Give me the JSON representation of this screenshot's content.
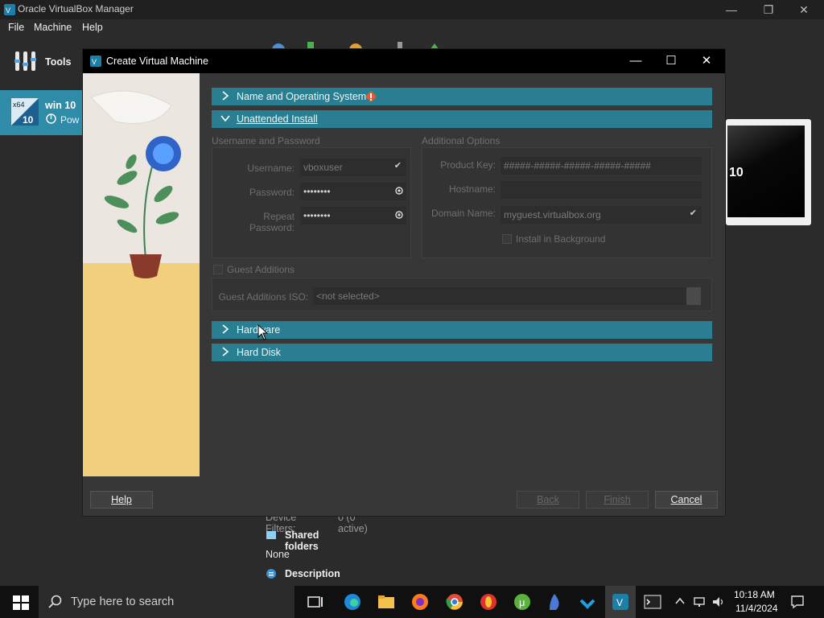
{
  "manager": {
    "title": "Oracle VirtualBox Manager",
    "menu": [
      "File",
      "Machine",
      "Help"
    ],
    "tools_label": "Tools",
    "vm": {
      "name": "win 10",
      "state": "Pow",
      "os_badge": "x64",
      "os_version": "10"
    },
    "preview_text": "10",
    "details": {
      "device_filters_label": "Device Filters:",
      "device_filters_value": "0 (0 active)",
      "shared_folders_header": "Shared folders",
      "shared_folders_value": "None",
      "description_header": "Description"
    }
  },
  "dialog": {
    "title": "Create Virtual Machine",
    "sections": {
      "name_os": "Name and Operating System",
      "unattended": "Unattended Install",
      "hardware": "Hardware",
      "hard_disk": "Hard Disk"
    },
    "user_group": {
      "title": "Username and Password",
      "username_label": "Username:",
      "username_value": "vboxuser",
      "password_label": "Password:",
      "password_value": "••••••••",
      "repeat_label": "Repeat Password:",
      "repeat_value": "••••••••"
    },
    "additional_group": {
      "title": "Additional Options",
      "product_key_label": "Product Key:",
      "product_key_placeholder": "#####-#####-#####-#####-#####",
      "hostname_label": "Hostname:",
      "hostname_value": "",
      "domain_label": "Domain Name:",
      "domain_value": "myguest.virtualbox.org",
      "install_bg_label": "Install in Background"
    },
    "guest_additions": {
      "label": "Guest Additions",
      "iso_label": "Guest Additions ISO:",
      "iso_value": "<not selected>"
    },
    "buttons": {
      "help": "Help",
      "back": "Back",
      "finish": "Finish",
      "cancel": "Cancel"
    }
  },
  "taskbar": {
    "search_placeholder": "Type here to search",
    "time": "10:18 AM",
    "date": "11/4/2024"
  },
  "colors": {
    "section_teal": "#297f91",
    "vm_selected": "#2e8ca8",
    "warning_orange": "#e8572e"
  }
}
